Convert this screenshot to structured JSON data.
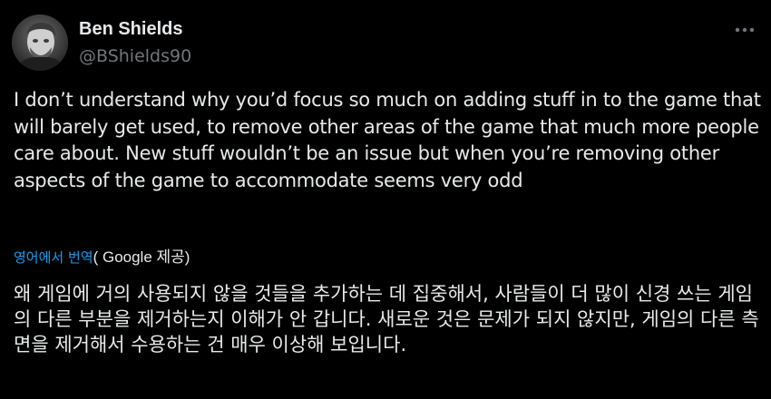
{
  "author": {
    "display_name": "Ben Shields",
    "handle": "@BShields90"
  },
  "tweet": {
    "text": "I don’t understand why you’d focus so much on adding stuff in to the game that will barely get used, to remove other areas of the game that much more people care about. New stuff wouldn’t be an issue but when you’re removing other aspects of the game to accommodate seems very odd"
  },
  "translation": {
    "link_label": "영어에서 번역",
    "provider_prefix": "( ",
    "provider_name": "Google",
    "provider_suffix": " 제공)",
    "text": "왜 게임에 거의 사용되지 않을 것들을 추가하는 데 집중해서, 사람들이 더 많이 신경 쓰는 게임의 다른 부분을 제거하는지 이해가 안 갑니다. 새로운 것은 문제가 되지 않지만, 게임의 다른 측면을 제거해서 수용하는 건 매우 이상해 보입니다."
  },
  "icons": {
    "more": "more-horizontal-icon",
    "avatar": "user-avatar"
  },
  "colors": {
    "background": "#000000",
    "primary_text": "#e7e9ea",
    "secondary_text": "#71767b",
    "link": "#1d9bf0"
  }
}
